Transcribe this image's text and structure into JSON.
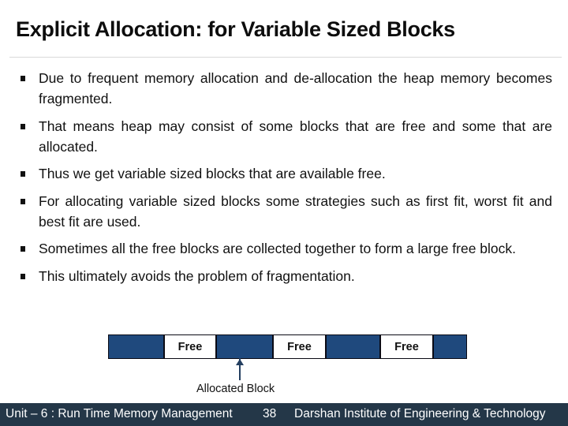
{
  "slide": {
    "title": "Explicit Allocation: for Variable Sized Blocks",
    "bullets": [
      "Due to frequent memory allocation and de-allocation the heap memory becomes fragmented.",
      "That means heap may consist of some blocks that are free and some that are allocated.",
      "Thus we get variable sized blocks that are available free.",
      "For allocating variable sized blocks some strategies such as first fit, worst fit and best fit are used.",
      "Sometimes all the free blocks are collected together to form a large free block.",
      "This ultimately avoids the problem of fragmentation."
    ]
  },
  "diagram": {
    "segments": [
      {
        "type": "allocated",
        "label": ""
      },
      {
        "type": "free",
        "label": "Free"
      },
      {
        "type": "allocated",
        "label": ""
      },
      {
        "type": "free",
        "label": "Free"
      },
      {
        "type": "allocated",
        "label": ""
      },
      {
        "type": "free",
        "label": "Free"
      },
      {
        "type": "allocated",
        "label": ""
      }
    ],
    "pointer_label": "Allocated Block",
    "colors": {
      "allocated": "#1f497d",
      "free": "#ffffff",
      "arrow": "#243f60"
    }
  },
  "footer": {
    "unit": "Unit – 6 : Run Time Memory Management",
    "page": "38",
    "institute": "Darshan Institute of Engineering & Technology",
    "background": "#243748"
  }
}
